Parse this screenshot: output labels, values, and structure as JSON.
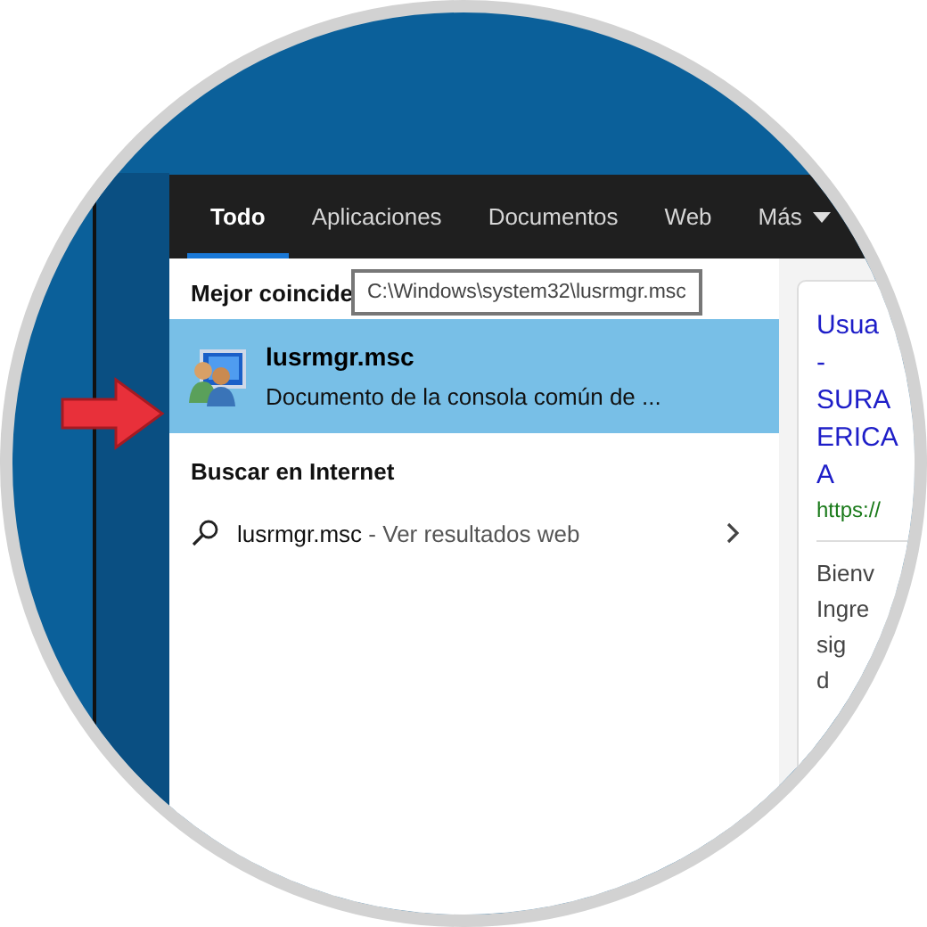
{
  "tabs": [
    {
      "label": "Todo",
      "selected": true,
      "kind": "tab"
    },
    {
      "label": "Aplicaciones",
      "selected": false,
      "kind": "tab"
    },
    {
      "label": "Documentos",
      "selected": false,
      "kind": "tab"
    },
    {
      "label": "Web",
      "selected": false,
      "kind": "tab"
    },
    {
      "label": "Más",
      "selected": false,
      "kind": "menu"
    }
  ],
  "tooltip": "C:\\Windows\\system32\\lusrmgr.msc",
  "best_match": {
    "heading": "Mejor coincide",
    "result": {
      "title": "lusrmgr.msc",
      "subtitle": "Documento de la consola común de ...",
      "selected": true
    }
  },
  "web": {
    "heading": "Buscar en Internet",
    "query": "lusrmgr.msc",
    "suffix": " - Ver resultados web"
  },
  "preview": {
    "title_lines": [
      "Usua",
      "-",
      "SURA",
      "ERICA",
      "A"
    ],
    "url": "https://",
    "snippet_lines": [
      "Bienv",
      "Ingre",
      "sig",
      "d"
    ]
  }
}
